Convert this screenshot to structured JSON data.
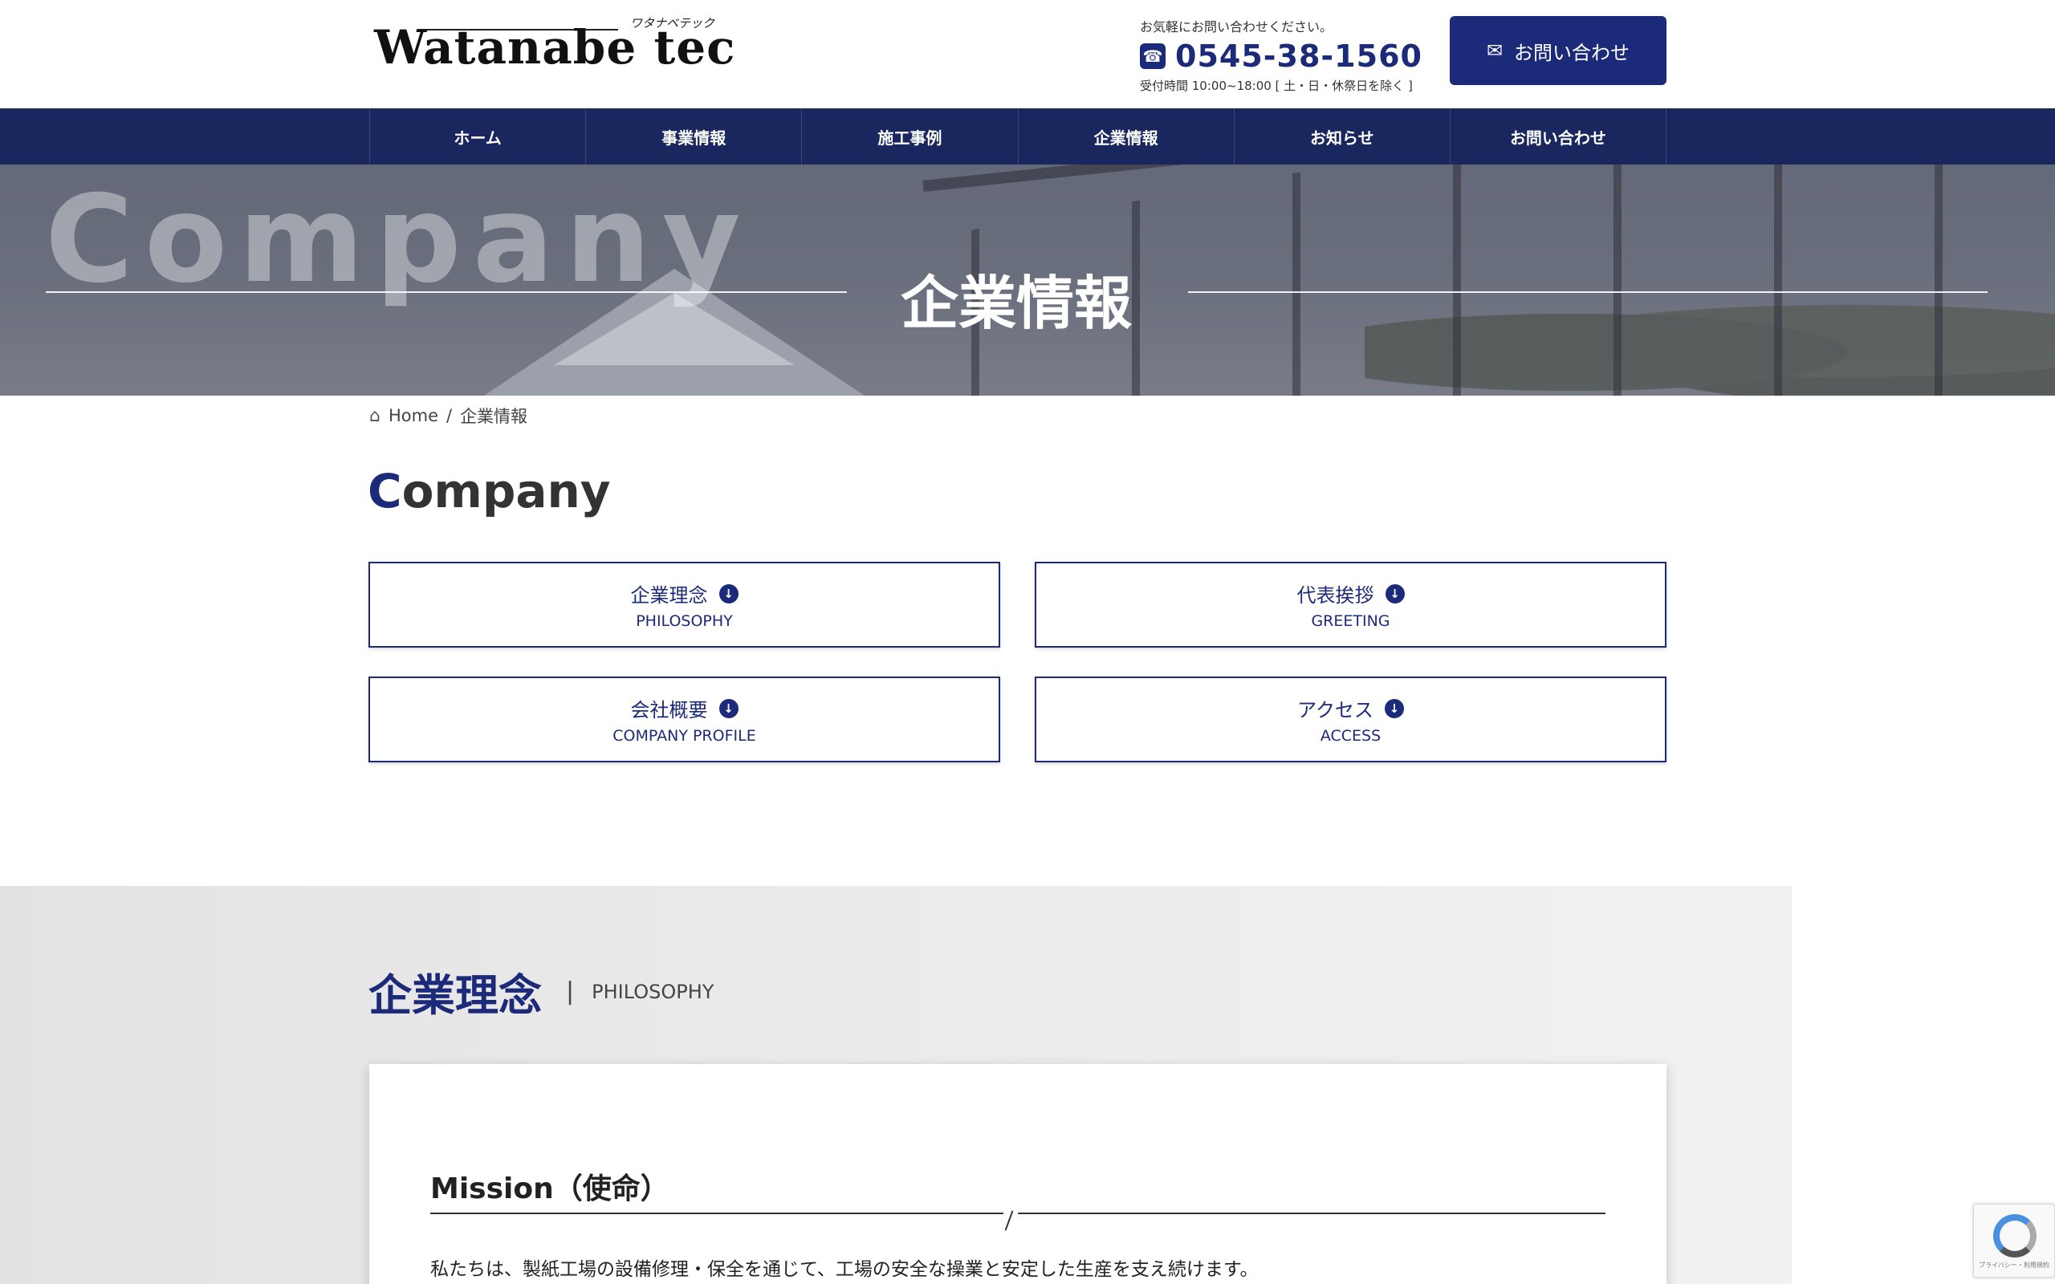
{
  "header": {
    "logo_main": "Watanabe tec",
    "logo_kana": "ワタナベテック",
    "contact_note": "お気軽にお問い合わせください。",
    "phone": "0545-38-1560",
    "hours": "受付時間 10:00~18:00 [ 土・日・休祭日を除く ]",
    "cta_label": "お問い合わせ"
  },
  "nav": {
    "items": [
      {
        "label": "ホーム"
      },
      {
        "label": "事業情報"
      },
      {
        "label": "施工事例"
      },
      {
        "label": "企業情報"
      },
      {
        "label": "お知らせ"
      },
      {
        "label": "お問い合わせ"
      }
    ]
  },
  "hero": {
    "title_en": "Company",
    "title_ja": "企業情報"
  },
  "breadcrumb": {
    "home": "Home",
    "separator": "/",
    "current": "企業情報"
  },
  "page_heading": {
    "accent": "C",
    "rest": "ompany"
  },
  "anchors": [
    {
      "ja": "企業理念",
      "en": "PHILOSOPHY"
    },
    {
      "ja": "代表挨拶",
      "en": "GREETING"
    },
    {
      "ja": "会社概要",
      "en": "COMPANY PROFILE"
    },
    {
      "ja": "アクセス",
      "en": "ACCESS"
    }
  ],
  "philosophy": {
    "title_ja": "企業理念",
    "separator": "|",
    "title_en": "PHILOSOPHY",
    "mission_title": "Mission（使命）",
    "mission_text": "私たちは、製紙工場の設備修理・保全を通じて、工場の安全な操業と安定した生産を支え続けます。"
  },
  "recaptcha": {
    "text": "プライバシー・利用規約"
  },
  "colors": {
    "brand": "#1c2a7a",
    "nav_bg": "#19275e"
  }
}
